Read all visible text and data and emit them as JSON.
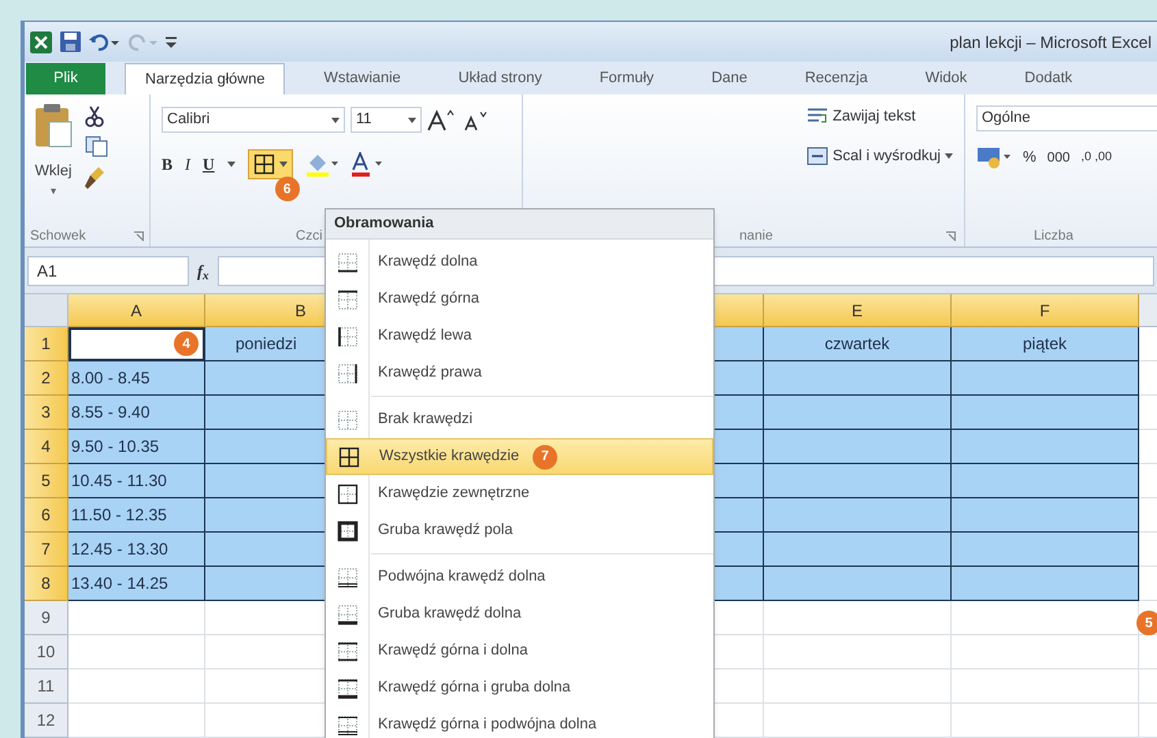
{
  "window": {
    "title": "plan lekcji – Microsoft Excel"
  },
  "tabs": [
    {
      "label": "Plik",
      "kind": "file",
      "selected": false
    },
    {
      "label": "Narzędzia główne",
      "kind": "tab",
      "selected": true
    },
    {
      "label": "Wstawianie",
      "kind": "tab",
      "selected": false
    },
    {
      "label": "Układ strony",
      "kind": "tab",
      "selected": false
    },
    {
      "label": "Formuły",
      "kind": "tab",
      "selected": false
    },
    {
      "label": "Dane",
      "kind": "tab",
      "selected": false
    },
    {
      "label": "Recenzja",
      "kind": "tab",
      "selected": false
    },
    {
      "label": "Widok",
      "kind": "tab",
      "selected": false
    },
    {
      "label": "Dodatk",
      "kind": "tab",
      "selected": false
    }
  ],
  "ribbon": {
    "clipboard": {
      "paste": "Wklej",
      "paste_arrow": "▾",
      "label": "Schowek"
    },
    "font": {
      "name": "Calibri",
      "size": "11",
      "bold": "B",
      "italic": "I",
      "underline": "U",
      "border_callout": "6",
      "label": "Czci"
    },
    "alignment": {
      "wrap": "Zawijaj tekst",
      "merge": "Scal i wyśrodkuj",
      "label": "nanie"
    },
    "number": {
      "format": "Ogólne",
      "percent": "%",
      "thousands": "000",
      "decimals": ",0 ,00",
      "label": "Liczba"
    }
  },
  "formula_bar": {
    "name_box": "A1",
    "fx": "f$_{x}$"
  },
  "columns": [
    {
      "label": "A",
      "selected": true
    },
    {
      "label": "B",
      "selected": true
    },
    {
      "selected": true
    },
    {
      "label": "E",
      "selected": true
    },
    {
      "label": "F",
      "selected": true
    },
    {
      "selected": false
    }
  ],
  "rows": [
    {
      "number": "1",
      "selected": true,
      "a_active": true,
      "callout": "4",
      "col_b": "poniedzi",
      "col_e": "czwartek",
      "col_f": "piątek"
    },
    {
      "number": "2",
      "selected": true,
      "a_active": false,
      "col_a": "8.00 - 8.45"
    },
    {
      "number": "3",
      "selected": true,
      "a_active": false,
      "col_a": "8.55 - 9.40"
    },
    {
      "number": "4",
      "selected": true,
      "a_active": false,
      "col_a": "9.50 - 10.35"
    },
    {
      "number": "5",
      "selected": true,
      "a_active": false,
      "col_a": "10.45 - 11.30"
    },
    {
      "number": "6",
      "selected": true,
      "a_active": false,
      "col_a": "11.50 - 12.35"
    },
    {
      "number": "7",
      "selected": true,
      "a_active": false,
      "col_a": "12.45 - 13.30"
    },
    {
      "number": "8",
      "selected": true,
      "a_active": false,
      "col_a": "13.40 - 14.25"
    },
    {
      "number": "9",
      "selected": false,
      "a_active": false
    },
    {
      "number": "10",
      "selected": false,
      "a_active": false
    },
    {
      "number": "11",
      "selected": false,
      "a_active": false
    },
    {
      "number": "12",
      "selected": false,
      "a_active": false
    }
  ],
  "selection_callout": "5",
  "border_menu": {
    "title": "Obramowania",
    "groups": [
      {
        "items": [
          {
            "label": "Krawędź dolna",
            "kind": "bottom",
            "selected": false
          },
          {
            "label": "Krawędź górna",
            "kind": "top",
            "selected": false
          },
          {
            "label": "Krawędź lewa",
            "kind": "left",
            "selected": false
          },
          {
            "label": "Krawędź prawa",
            "kind": "right",
            "selected": false
          }
        ]
      },
      {
        "items": [
          {
            "label": "Brak krawędzi",
            "kind": "none",
            "selected": false
          },
          {
            "label": "Wszystkie krawędzie",
            "kind": "all",
            "selected": true,
            "callout": "7"
          },
          {
            "label": "Krawędzie zewnętrzne",
            "kind": "outside",
            "selected": false
          },
          {
            "label": "Gruba krawędź pola",
            "kind": "thick_box",
            "selected": false
          }
        ]
      },
      {
        "items": [
          {
            "label": "Podwójna krawędź dolna",
            "kind": "double_bottom",
            "selected": false
          },
          {
            "label": "Gruba krawędź dolna",
            "kind": "thick_bottom",
            "selected": false
          },
          {
            "label": "Krawędź górna i dolna",
            "kind": "top_bottom",
            "selected": false
          },
          {
            "label": "Krawędź górna i gruba dolna",
            "kind": "top_thick_bottom",
            "selected": false
          },
          {
            "label": "Krawędź górna i podwójna dolna",
            "kind": "top_double_bottom",
            "selected": false
          }
        ]
      }
    ]
  }
}
